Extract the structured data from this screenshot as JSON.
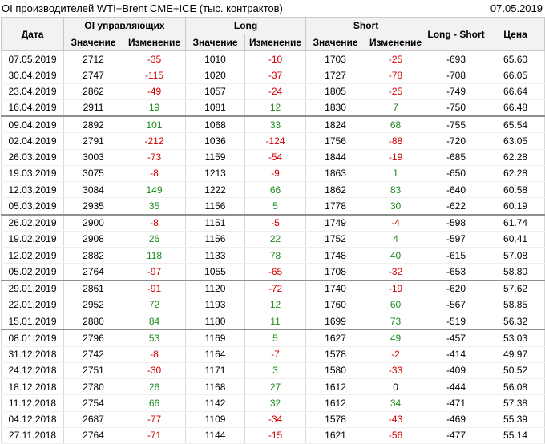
{
  "header": {
    "title": "OI производителей WTI+Brent CME+ICE (тыс. контрактов)",
    "date": "07.05.2019"
  },
  "columns": {
    "date": "Дата",
    "oi_group": "OI управляющих",
    "long_group": "Long",
    "short_group": "Short",
    "long_short": "Long - Short",
    "price": "Цена",
    "value": "Значение",
    "change": "Изменение"
  },
  "rows": [
    {
      "date": "07.05.2019",
      "oi": "2712",
      "oi_chg": "-35",
      "long": "1010",
      "long_chg": "-10",
      "short": "1703",
      "short_chg": "-25",
      "ls": "-693",
      "price": "65.60",
      "sep": false
    },
    {
      "date": "30.04.2019",
      "oi": "2747",
      "oi_chg": "-115",
      "long": "1020",
      "long_chg": "-37",
      "short": "1727",
      "short_chg": "-78",
      "ls": "-708",
      "price": "66.05",
      "sep": false
    },
    {
      "date": "23.04.2019",
      "oi": "2862",
      "oi_chg": "-49",
      "long": "1057",
      "long_chg": "-24",
      "short": "1805",
      "short_chg": "-25",
      "ls": "-749",
      "price": "66.64",
      "sep": false
    },
    {
      "date": "16.04.2019",
      "oi": "2911",
      "oi_chg": "19",
      "long": "1081",
      "long_chg": "12",
      "short": "1830",
      "short_chg": "7",
      "ls": "-750",
      "price": "66.48",
      "sep": false
    },
    {
      "date": "09.04.2019",
      "oi": "2892",
      "oi_chg": "101",
      "long": "1068",
      "long_chg": "33",
      "short": "1824",
      "short_chg": "68",
      "ls": "-755",
      "price": "65.54",
      "sep": true
    },
    {
      "date": "02.04.2019",
      "oi": "2791",
      "oi_chg": "-212",
      "long": "1036",
      "long_chg": "-124",
      "short": "1756",
      "short_chg": "-88",
      "ls": "-720",
      "price": "63.05",
      "sep": false
    },
    {
      "date": "26.03.2019",
      "oi": "3003",
      "oi_chg": "-73",
      "long": "1159",
      "long_chg": "-54",
      "short": "1844",
      "short_chg": "-19",
      "ls": "-685",
      "price": "62.28",
      "sep": false
    },
    {
      "date": "19.03.2019",
      "oi": "3075",
      "oi_chg": "-8",
      "long": "1213",
      "long_chg": "-9",
      "short": "1863",
      "short_chg": "1",
      "ls": "-650",
      "price": "62.28",
      "sep": false
    },
    {
      "date": "12.03.2019",
      "oi": "3084",
      "oi_chg": "149",
      "long": "1222",
      "long_chg": "66",
      "short": "1862",
      "short_chg": "83",
      "ls": "-640",
      "price": "60.58",
      "sep": false
    },
    {
      "date": "05.03.2019",
      "oi": "2935",
      "oi_chg": "35",
      "long": "1156",
      "long_chg": "5",
      "short": "1778",
      "short_chg": "30",
      "ls": "-622",
      "price": "60.19",
      "sep": false
    },
    {
      "date": "26.02.2019",
      "oi": "2900",
      "oi_chg": "-8",
      "long": "1151",
      "long_chg": "-5",
      "short": "1749",
      "short_chg": "-4",
      "ls": "-598",
      "price": "61.74",
      "sep": true
    },
    {
      "date": "19.02.2019",
      "oi": "2908",
      "oi_chg": "26",
      "long": "1156",
      "long_chg": "22",
      "short": "1752",
      "short_chg": "4",
      "ls": "-597",
      "price": "60.41",
      "sep": false
    },
    {
      "date": "12.02.2019",
      "oi": "2882",
      "oi_chg": "118",
      "long": "1133",
      "long_chg": "78",
      "short": "1748",
      "short_chg": "40",
      "ls": "-615",
      "price": "57.08",
      "sep": false
    },
    {
      "date": "05.02.2019",
      "oi": "2764",
      "oi_chg": "-97",
      "long": "1055",
      "long_chg": "-65",
      "short": "1708",
      "short_chg": "-32",
      "ls": "-653",
      "price": "58.80",
      "sep": false
    },
    {
      "date": "29.01.2019",
      "oi": "2861",
      "oi_chg": "-91",
      "long": "1120",
      "long_chg": "-72",
      "short": "1740",
      "short_chg": "-19",
      "ls": "-620",
      "price": "57.62",
      "sep": true
    },
    {
      "date": "22.01.2019",
      "oi": "2952",
      "oi_chg": "72",
      "long": "1193",
      "long_chg": "12",
      "short": "1760",
      "short_chg": "60",
      "ls": "-567",
      "price": "58.85",
      "sep": false
    },
    {
      "date": "15.01.2019",
      "oi": "2880",
      "oi_chg": "84",
      "long": "1180",
      "long_chg": "11",
      "short": "1699",
      "short_chg": "73",
      "ls": "-519",
      "price": "56.32",
      "sep": false
    },
    {
      "date": "08.01.2019",
      "oi": "2796",
      "oi_chg": "53",
      "long": "1169",
      "long_chg": "5",
      "short": "1627",
      "short_chg": "49",
      "ls": "-457",
      "price": "53.03",
      "sep": true
    },
    {
      "date": "31.12.2018",
      "oi": "2742",
      "oi_chg": "-8",
      "long": "1164",
      "long_chg": "-7",
      "short": "1578",
      "short_chg": "-2",
      "ls": "-414",
      "price": "49.97",
      "sep": false
    },
    {
      "date": "24.12.2018",
      "oi": "2751",
      "oi_chg": "-30",
      "long": "1171",
      "long_chg": "3",
      "short": "1580",
      "short_chg": "-33",
      "ls": "-409",
      "price": "50.52",
      "sep": false
    },
    {
      "date": "18.12.2018",
      "oi": "2780",
      "oi_chg": "26",
      "long": "1168",
      "long_chg": "27",
      "short": "1612",
      "short_chg": "0",
      "ls": "-444",
      "price": "56.08",
      "sep": false
    },
    {
      "date": "11.12.2018",
      "oi": "2754",
      "oi_chg": "66",
      "long": "1142",
      "long_chg": "32",
      "short": "1612",
      "short_chg": "34",
      "ls": "-471",
      "price": "57.38",
      "sep": false
    },
    {
      "date": "04.12.2018",
      "oi": "2687",
      "oi_chg": "-77",
      "long": "1109",
      "long_chg": "-34",
      "short": "1578",
      "short_chg": "-43",
      "ls": "-469",
      "price": "55.39",
      "sep": false
    },
    {
      "date": "27.11.2018",
      "oi": "2764",
      "oi_chg": "-71",
      "long": "1144",
      "long_chg": "-15",
      "short": "1621",
      "short_chg": "-56",
      "ls": "-477",
      "price": "55.14",
      "sep": false
    }
  ],
  "colors": {
    "positive": "#1e8a1e",
    "negative": "#d40000",
    "header_bg": "#f2f2f2"
  }
}
